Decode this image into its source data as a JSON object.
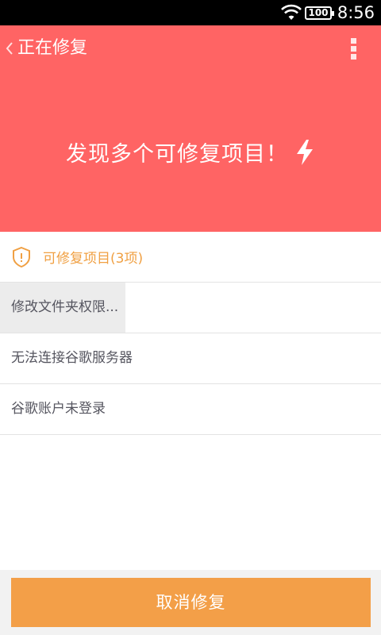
{
  "status_bar": {
    "battery": "100",
    "time": "8:56",
    "wifi_icon": "wifi-icon"
  },
  "header": {
    "title": "正在修复",
    "back_icon": "chevron-left-icon",
    "menu_icon": "more-vertical-icon"
  },
  "hero": {
    "message": "发现多个可修复项目！",
    "icon": "lightning-bolt-icon",
    "background": "#ff6464"
  },
  "section": {
    "label": "可修复项目(3项)",
    "icon": "shield-alert-icon",
    "accent": "#f0a043"
  },
  "items": [
    {
      "label": "修改文件夹权限...",
      "progress": 0.33
    },
    {
      "label": "无法连接谷歌服务器",
      "progress": 0
    },
    {
      "label": "谷歌账户未登录",
      "progress": 0
    }
  ],
  "footer": {
    "cancel_label": "取消修复",
    "button_color": "#f39f48"
  }
}
